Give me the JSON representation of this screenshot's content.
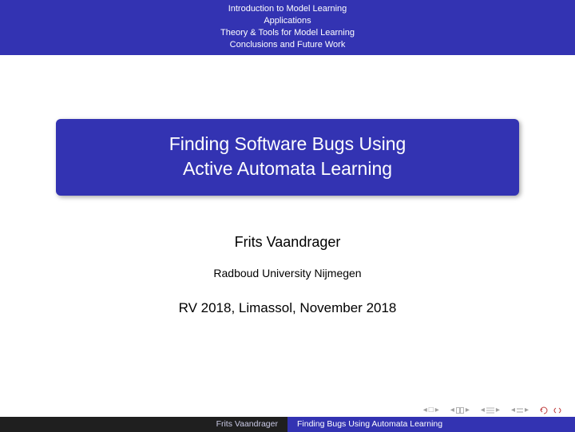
{
  "outline": {
    "items": [
      "Introduction to Model Learning",
      "Applications",
      "Theory & Tools for Model Learning",
      "Conclusions and Future Work"
    ]
  },
  "title": {
    "line1": "Finding Software Bugs Using",
    "line2": "Active Automata Learning"
  },
  "author": "Frits Vaandrager",
  "institute": "Radboud University Nijmegen",
  "date": "RV 2018, Limassol, November 2018",
  "footer": {
    "author": "Frits Vaandrager",
    "title": "Finding Bugs Using Automata Learning"
  }
}
